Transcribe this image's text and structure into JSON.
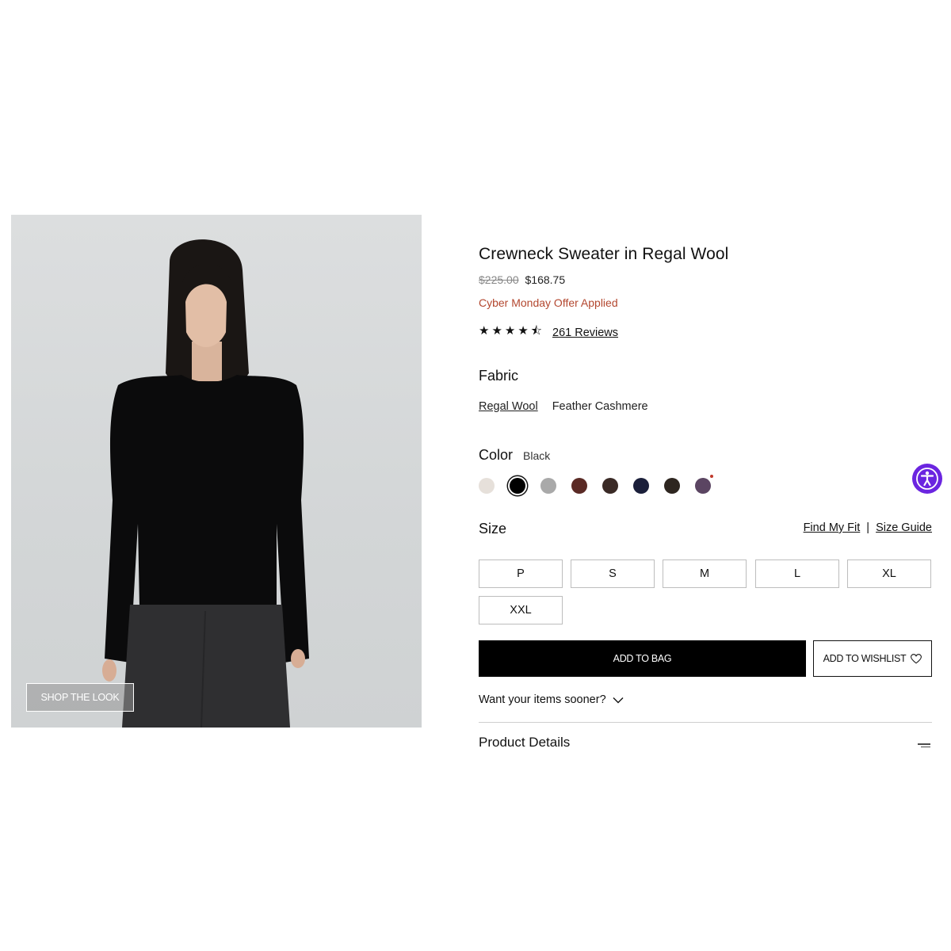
{
  "product": {
    "title": "Crewneck Sweater in Regal Wool",
    "original_price": "$225.00",
    "sale_price": "$168.75",
    "offer": "Cyber Monday Offer Applied",
    "rating": 4.5,
    "stars": "★★★★⯪",
    "reviews_label": "261 Reviews"
  },
  "image": {
    "shop_the_look_label": "SHOP THE LOOK"
  },
  "fabric": {
    "label": "Fabric",
    "options": [
      "Regal Wool",
      "Feather Cashmere"
    ],
    "selected": "Regal Wool"
  },
  "color": {
    "label": "Color",
    "selected_name": "Black",
    "swatches": [
      {
        "hex": "#e6e0da"
      },
      {
        "hex": "#000000",
        "selected": true
      },
      {
        "hex": "#a9a9a9"
      },
      {
        "hex": "#5a2a25"
      },
      {
        "hex": "#3a2a26"
      },
      {
        "hex": "#1b1f3a"
      },
      {
        "hex": "#2e2620"
      },
      {
        "hex": "#5b4562",
        "new_dot": true
      }
    ]
  },
  "size": {
    "label": "Size",
    "find_my_fit": "Find My Fit",
    "separator": "|",
    "size_guide": "Size Guide",
    "options": [
      "P",
      "S",
      "M",
      "L",
      "XL",
      "XXL"
    ]
  },
  "actions": {
    "add_to_bag": "ADD TO BAG",
    "add_to_wishlist": "ADD TO WISHLIST",
    "want_sooner": "Want your items sooner?"
  },
  "details": {
    "label": "Product Details"
  },
  "colors": {
    "offer_red": "#b3472f",
    "accessibility_purple": "#6b25e0"
  }
}
